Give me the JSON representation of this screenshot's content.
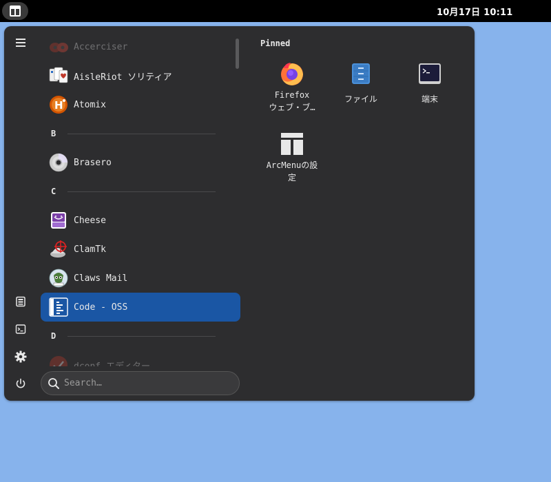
{
  "topbar": {
    "clock": "10月17日  10:11",
    "activities_icon": "layout-icon"
  },
  "sidebar": {
    "buttons": [
      {
        "name": "hamburger-menu-icon"
      },
      {
        "name": "files-icon"
      },
      {
        "name": "terminal-icon"
      },
      {
        "name": "settings-gear-icon"
      },
      {
        "name": "power-icon"
      }
    ]
  },
  "apps": {
    "items": [
      {
        "label": "Accerciser",
        "icon": "accerciser-icon"
      },
      {
        "label": "AisleRiot ソリティア",
        "icon": "aisleriot-cards-icon"
      },
      {
        "label": "Atomix",
        "icon": "atomix-icon"
      },
      {
        "section": "B"
      },
      {
        "label": "Brasero",
        "icon": "brasero-disc-icon"
      },
      {
        "section": "C"
      },
      {
        "label": "Cheese",
        "icon": "cheese-camera-icon"
      },
      {
        "label": "ClamTk",
        "icon": "clamtk-icon"
      },
      {
        "label": "Claws Mail",
        "icon": "claws-mail-icon"
      },
      {
        "label": "Code - OSS",
        "icon": "code-oss-icon",
        "selected": true
      },
      {
        "section": "D"
      },
      {
        "label": "dconf エディター",
        "icon": "dconf-editor-icon"
      }
    ]
  },
  "search": {
    "placeholder": "Search…"
  },
  "pinned": {
    "title": "Pinned",
    "items": [
      {
        "line1": "Firefox",
        "line2": "ウェブ・ブ…",
        "icon": "firefox-icon"
      },
      {
        "line1": "ファイル",
        "line2": "",
        "icon": "files-icon"
      },
      {
        "line1": "端末",
        "line2": "",
        "icon": "terminal-icon"
      },
      {
        "line1": "ArcMenuの設",
        "line2": "定",
        "icon": "arcmenu-settings-icon"
      }
    ]
  },
  "colors": {
    "desktop": "#87b3ec",
    "panel": "#2d2d2f",
    "selection": "#1a56a4"
  }
}
